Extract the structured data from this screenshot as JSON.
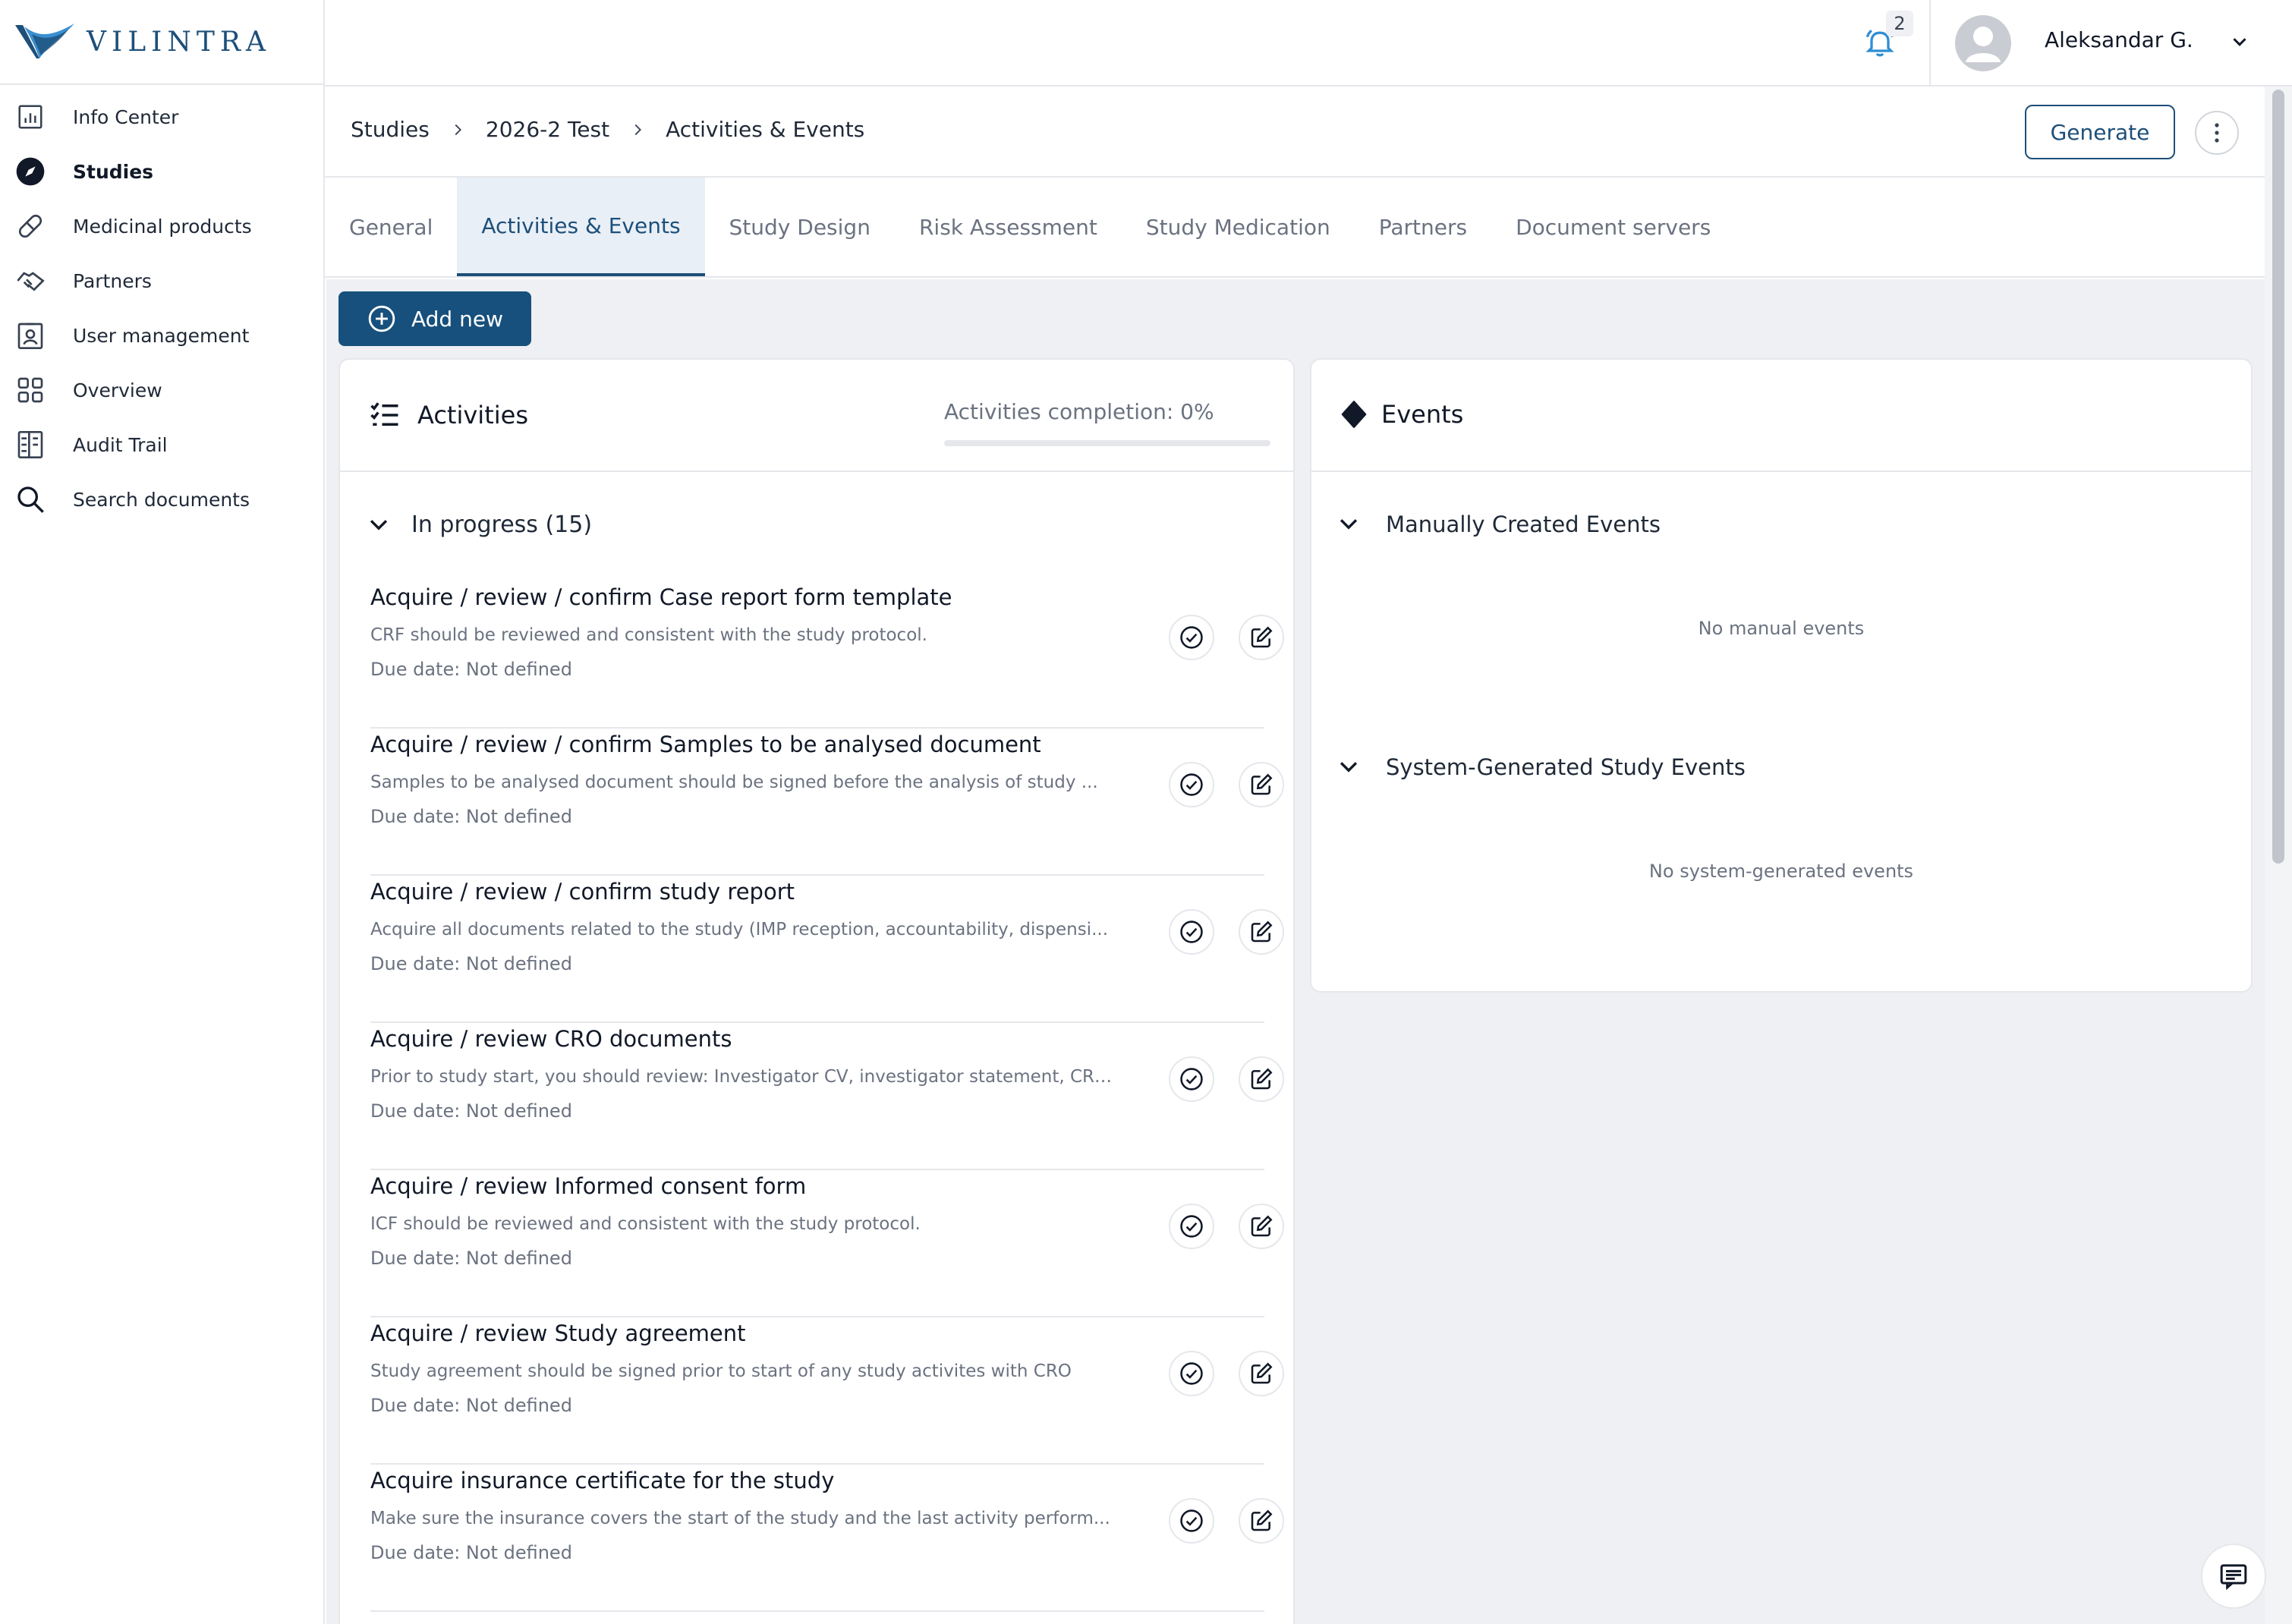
{
  "brand": {
    "name": "VILINTRA",
    "color": "#1d4f79"
  },
  "sidebar": {
    "items": [
      {
        "label": "Info Center",
        "icon": "chart-icon"
      },
      {
        "label": "Studies",
        "icon": "compass-icon",
        "active": true
      },
      {
        "label": "Medicinal products",
        "icon": "pill-icon"
      },
      {
        "label": "Partners",
        "icon": "handshake-icon"
      },
      {
        "label": "User management",
        "icon": "user-badge-icon"
      },
      {
        "label": "Overview",
        "icon": "grid-icon"
      },
      {
        "label": "Audit Trail",
        "icon": "ledger-icon"
      },
      {
        "label": "Search documents",
        "icon": "search-icon"
      }
    ]
  },
  "topbar": {
    "notification_count": "2",
    "user_name": "Aleksandar G."
  },
  "breadcrumb": [
    "Studies",
    "2026-2 Test",
    "Activities & Events"
  ],
  "header": {
    "generate_label": "Generate"
  },
  "tabs": [
    {
      "label": "General"
    },
    {
      "label": "Activities & Events",
      "active": true
    },
    {
      "label": "Study Design"
    },
    {
      "label": "Risk Assessment"
    },
    {
      "label": "Study Medication"
    },
    {
      "label": "Partners"
    },
    {
      "label": "Document servers"
    }
  ],
  "actions": {
    "add_new_label": "Add new"
  },
  "activities": {
    "title": "Activities",
    "completion_label": "Activities completion: 0%",
    "completion_value": 0,
    "group_label": "In progress (15)",
    "items": [
      {
        "title": "Acquire / review / confirm Case report form template",
        "description": "CRF should be reviewed and consistent with the study protocol.",
        "due": "Due date: Not defined"
      },
      {
        "title": "Acquire / review / confirm Samples to be analysed document",
        "description": "Samples to be analysed document should be signed before the analysis of study ...",
        "due": "Due date: Not defined"
      },
      {
        "title": "Acquire / review / confirm study report",
        "description": "Acquire all documents related to the study (IMP reception, accountability, dispensi...",
        "due": "Due date: Not defined"
      },
      {
        "title": "Acquire / review CRO documents",
        "description": "Prior to study start, you should review: Investigator CV, investigator statement, CRO...",
        "due": "Due date: Not defined"
      },
      {
        "title": "Acquire / review Informed consent form",
        "description": "ICF should be reviewed and consistent with the study protocol.",
        "due": "Due date: Not defined"
      },
      {
        "title": "Acquire / review Study agreement",
        "description": "Study agreement should be signed prior to start of any study activites with CRO",
        "due": "Due date: Not defined"
      },
      {
        "title": "Acquire insurance certificate for the study",
        "description": "Make sure the insurance covers the start of the study and the last activity perform...",
        "due": "Due date: Not defined"
      }
    ]
  },
  "events": {
    "title": "Events",
    "manual_label": "Manually Created Events",
    "manual_empty": "No manual events",
    "system_label": "System-Generated Study Events",
    "system_empty": "No system-generated events"
  }
}
